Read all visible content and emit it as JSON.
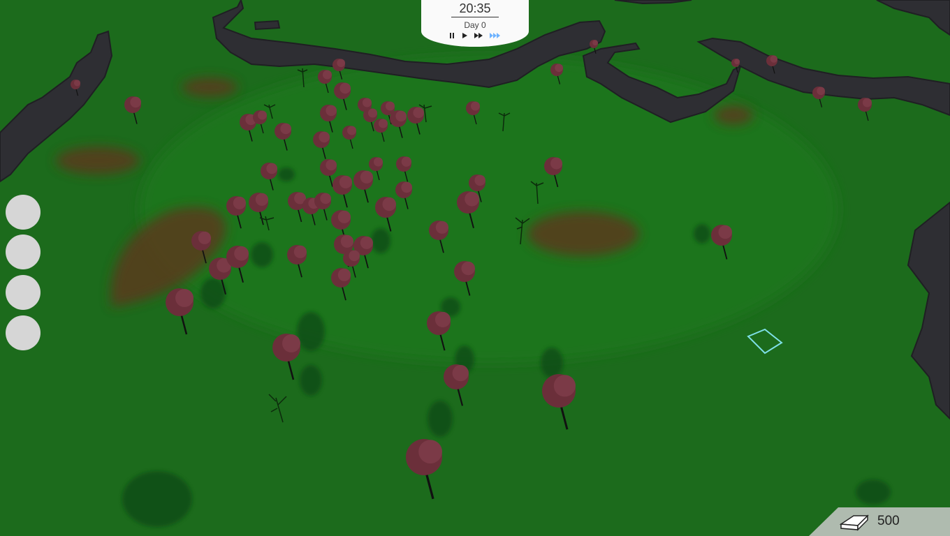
{
  "hud": {
    "clock": {
      "time": "20:35",
      "day": "Day 0",
      "controls": {
        "pause_icon": "pause-icon",
        "play_icon": "play-icon",
        "fast_icon": "fast-forward-icon",
        "fastest_icon": "fastest-forward-icon",
        "active": "fastest"
      }
    },
    "side_buttons": [
      "circle-button",
      "circle-button",
      "circle-button",
      "circle-button"
    ],
    "resource": {
      "icon": "ingot-icon",
      "value": "500"
    }
  },
  "colors": {
    "grass": "#1c6b1c",
    "cliff": "#2e2e33",
    "tree_foliage": "#6b2f3a",
    "dirt": "#5a3a1e",
    "selection_outline": "#7fe0e8",
    "hud_panel": "#fafafa",
    "speed_active": "#6fb3ff"
  }
}
